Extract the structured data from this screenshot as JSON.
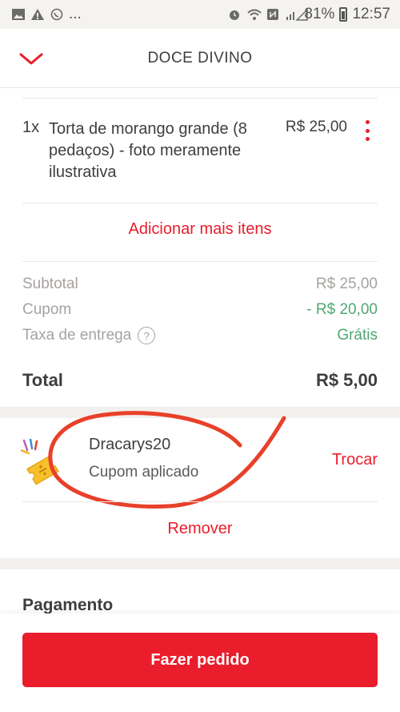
{
  "status_bar": {
    "battery": "81%",
    "time": "12:57",
    "overflow": "..."
  },
  "header": {
    "title": "DOCE DIVINO"
  },
  "item": {
    "quantity": "1x",
    "name": "Torta  de morango grande (8 pedaços) - foto meramente ilustrativa",
    "price": "R$ 25,00"
  },
  "add_more_label": "Adicionar mais itens",
  "summary": {
    "subtotal_label": "Subtotal",
    "subtotal_value": "R$ 25,00",
    "coupon_label": "Cupom",
    "coupon_value": "- R$ 20,00",
    "delivery_label": "Taxa de entrega",
    "delivery_help": "?",
    "delivery_value": "Grátis",
    "total_label": "Total",
    "total_value": "R$ 5,00"
  },
  "coupon": {
    "code": "Dracarys20",
    "status": "Cupom aplicado",
    "change_label": "Trocar",
    "remove_label": "Remover"
  },
  "payment": {
    "title": "Pagamento"
  },
  "order_button_label": "Fazer pedido",
  "colors": {
    "accent": "#ea1d2c",
    "success": "#50a773",
    "annotation": "#e8402a"
  }
}
